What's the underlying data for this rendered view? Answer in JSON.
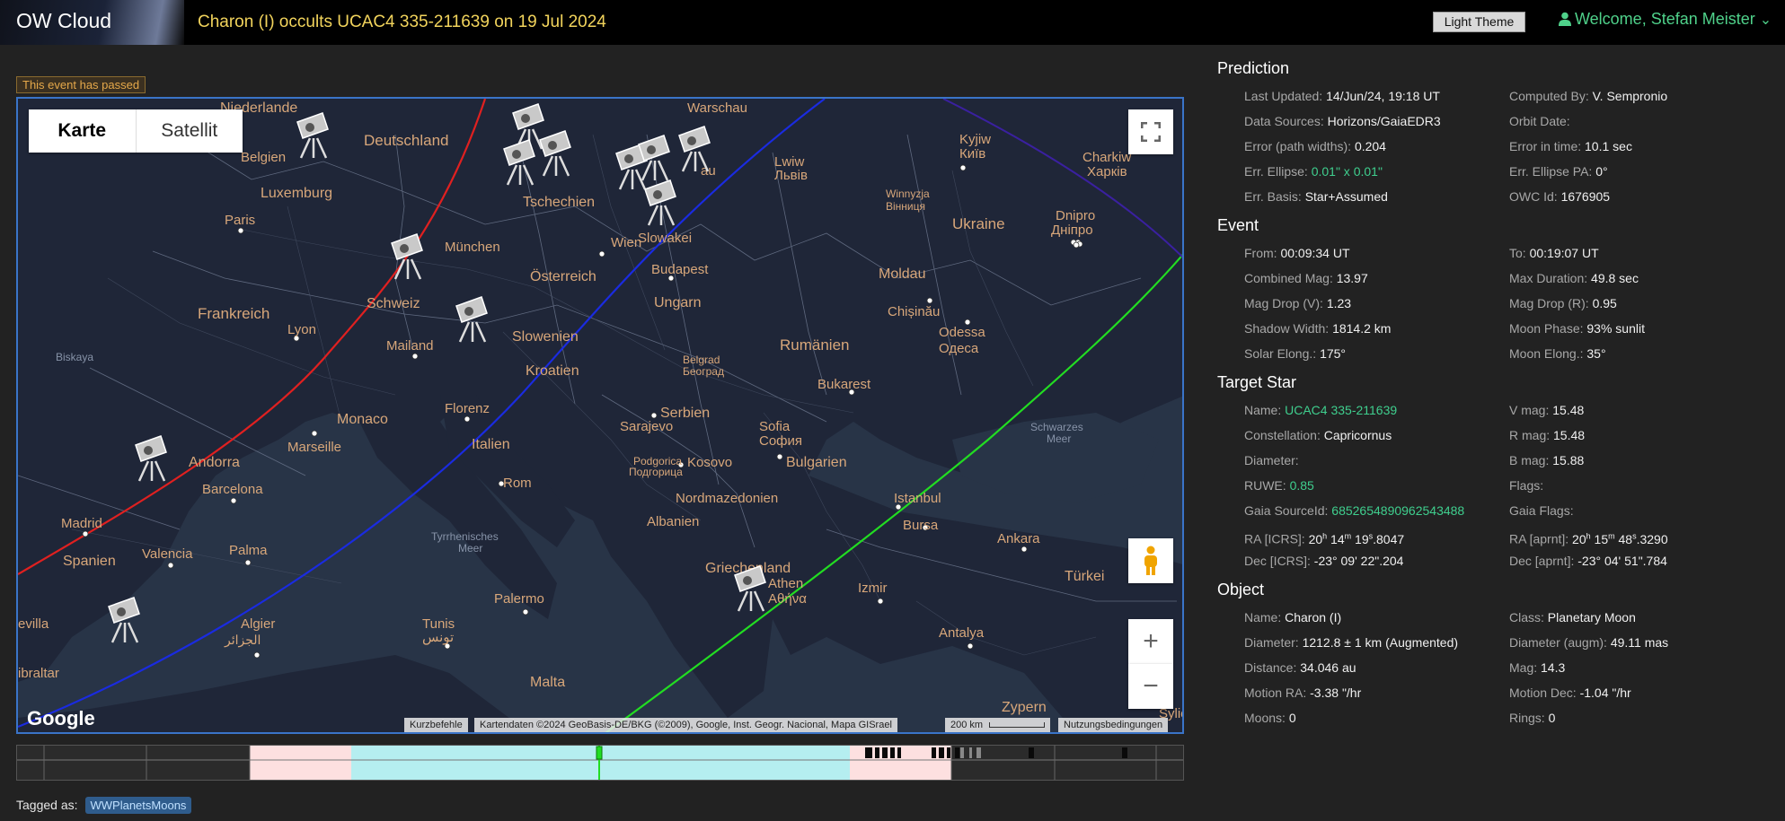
{
  "header": {
    "brand": "OW Cloud",
    "title": "Charon (I) occults UCAC4 335-211639 on 19 Jul 2024",
    "theme_button": "Light Theme",
    "welcome": "Welcome, Stefan Meister",
    "chevron": "⌄"
  },
  "status_badge": "This event has passed",
  "map": {
    "type_karte": "Karte",
    "type_satellit": "Satellit",
    "zoom_in": "+",
    "zoom_out": "−",
    "shortcuts": "Kurzbefehle",
    "copyright": "Kartendaten ©2024 GeoBasis-DE/BKG (©2009), Google, Inst. Geogr. Nacional, Mapa GISrael",
    "scale": "200 km",
    "terms": "Nutzungsbedingungen",
    "logo": "Google",
    "labels": [
      "Niederlande",
      "Warschau",
      "Deutschland",
      "Belgien",
      "Luxemburg",
      "Tschechien",
      "Paris",
      "München",
      "Wien",
      "Frankreich",
      "Schweiz",
      "Österreich",
      "Budapest",
      "Ungarn",
      "Lyon",
      "Mailand",
      "Slowenien",
      "Kroatien",
      "Monaco",
      "Marseille",
      "Andorra",
      "Barcelona",
      "Madrid",
      "Spanien",
      "Valencia",
      "Palma",
      "Florenz",
      "Italien",
      "Rom",
      "Sarajevo",
      "Serbien",
      "Belgrad",
      "Београд",
      "Sofia",
      "София",
      "Bulgarien",
      "Kosovo",
      "Podgorica",
      "Подгорица",
      "Albanien",
      "Nordmazedonien",
      "Griechenland",
      "Athen",
      "Αθήνα",
      "Istanbul",
      "Bursa",
      "Izmir",
      "Ankara",
      "Türkei",
      "Antalya",
      "Zypern",
      "Malta",
      "Palermo",
      "Tunis",
      "تونس",
      "Algier",
      "الجزائر",
      "Schwarzes",
      "Meer",
      "Tyrrhenisches",
      "Meer",
      "Kyjiw",
      "Київ",
      "Lwiw",
      "Львів",
      "Winnyzja",
      "Вінниця",
      "Charkiw",
      "Харків",
      "Ukraine",
      "Dnipro",
      "Дніпро",
      "Moldau",
      "Chișinău",
      "Odessa",
      "Одеса",
      "Rumänien",
      "Bukarest",
      "Biskaya",
      "evilla",
      "ibraltar",
      "Sylie",
      "Slowakei",
      "au"
    ]
  },
  "tags": {
    "label": "Tagged as:",
    "items": [
      "WWPlanetsMoons"
    ]
  },
  "prediction": {
    "title": "Prediction",
    "rows": [
      [
        {
          "label": "Last Updated:",
          "value": "14/Jun/24, 19:18 UT"
        },
        {
          "label": "Computed By:",
          "value": "V. Sempronio"
        }
      ],
      [
        {
          "label": "Data Sources:",
          "value": "Horizons/GaiaEDR3"
        },
        {
          "label": "Orbit Date:",
          "value": ""
        }
      ],
      [
        {
          "label": "Error (path widths):",
          "value": "0.204"
        },
        {
          "label": "Error in time:",
          "value": "10.1 sec"
        }
      ],
      [
        {
          "label": "Err. Ellipse:",
          "value": "0.01\" x 0.01\""
        },
        {
          "label": "Err. Ellipse PA:",
          "value": "0°"
        }
      ],
      [
        {
          "label": "Err. Basis:",
          "value": "Star+Assumed"
        },
        {
          "label": "OWC Id:",
          "value": "1676905"
        }
      ]
    ]
  },
  "event": {
    "title": "Event",
    "rows": [
      [
        {
          "label": "From:",
          "value": "00:09:34 UT"
        },
        {
          "label": "To:",
          "value": "00:19:07 UT"
        }
      ],
      [
        {
          "label": "Combined Mag:",
          "value": "13.97"
        },
        {
          "label": "Max Duration:",
          "value": "49.8 sec"
        }
      ],
      [
        {
          "label": "Mag Drop (V):",
          "value": "1.23"
        },
        {
          "label": "Mag Drop (R):",
          "value": "0.95"
        }
      ],
      [
        {
          "label": "Shadow Width:",
          "value": "1814.2 km"
        },
        {
          "label": "Moon Phase:",
          "value": "93% sunlit"
        }
      ],
      [
        {
          "label": "Solar Elong.:",
          "value": "175°"
        },
        {
          "label": "Moon Elong.:",
          "value": "35°"
        }
      ]
    ]
  },
  "target_star": {
    "title": "Target Star",
    "rows": [
      [
        {
          "label": "Name:",
          "value": "UCAC4 335-211639"
        },
        {
          "label": "V mag:",
          "value": "15.48"
        }
      ],
      [
        {
          "label": "Constellation:",
          "value": "Capricornus"
        },
        {
          "label": "R mag:",
          "value": "15.48"
        }
      ],
      [
        {
          "label": "Diameter:",
          "value": ""
        },
        {
          "label": "B mag:",
          "value": "15.88"
        }
      ],
      [
        {
          "label": "RUWE:",
          "value": "0.85"
        },
        {
          "label": "Flags:",
          "value": ""
        }
      ],
      [
        {
          "label": "Gaia SourceId:",
          "value": "6852654890962543488"
        },
        {
          "label": "Gaia Flags:",
          "value": ""
        }
      ],
      [
        {
          "label": "RA [ICRS]:",
          "value": "20h 14m 19s.8047"
        },
        {
          "label": "RA [aprnt]:",
          "value": "20h 15m 48s.3290"
        }
      ],
      [
        {
          "label": "Dec [ICRS]:",
          "value": "-23° 09' 22\".204"
        },
        {
          "label": "Dec [aprnt]:",
          "value": "-23° 04' 51\".784"
        }
      ]
    ]
  },
  "object": {
    "title": "Object",
    "rows": [
      [
        {
          "label": "Name:",
          "value": "Charon (I)"
        },
        {
          "label": "Class:",
          "value": "Planetary Moon"
        }
      ],
      [
        {
          "label": "Diameter:",
          "value": "1212.8 ± 1 km (Augmented)"
        },
        {
          "label": "Diameter (augm):",
          "value": "49.11 mas"
        }
      ],
      [
        {
          "label": "Distance:",
          "value": "34.046 au"
        },
        {
          "label": "Mag:",
          "value": "14.3"
        }
      ],
      [
        {
          "label": "Motion RA:",
          "value": "-3.38 \"/hr"
        },
        {
          "label": "Motion Dec:",
          "value": "-1.04 \"/hr"
        }
      ],
      [
        {
          "label": "Moons:",
          "value": "0"
        },
        {
          "label": "Rings:",
          "value": "0"
        }
      ]
    ]
  },
  "colors": {
    "path_red": "#e02020",
    "path_blue": "#1a2be0",
    "path_green": "#22dd22",
    "accent_green": "#3fcf8e",
    "title_yellow": "#f2d45c"
  }
}
